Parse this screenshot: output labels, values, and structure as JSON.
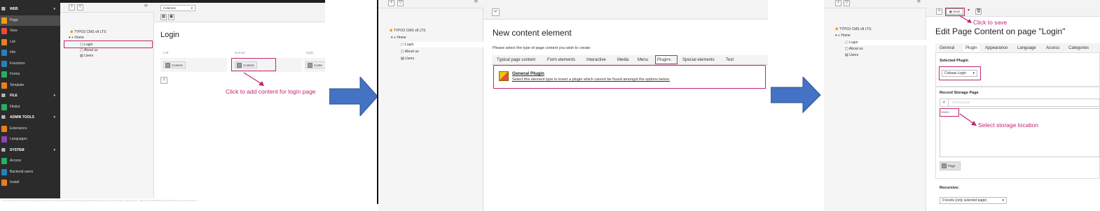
{
  "panel1": {
    "modules": [
      {
        "label": "WEB",
        "group": true,
        "color": "#e8e8e8"
      },
      {
        "label": "Page",
        "active": true,
        "color": "#f39c12"
      },
      {
        "label": "View",
        "color": "#e74c3c"
      },
      {
        "label": "List",
        "color": "#e67e22"
      },
      {
        "label": "Info",
        "color": "#2980b9"
      },
      {
        "label": "Functions",
        "color": "#2980b9"
      },
      {
        "label": "Forms",
        "color": "#27ae60"
      },
      {
        "label": "Template",
        "color": "#e67e22"
      },
      {
        "label": "FILE",
        "group": true,
        "color": "#e8e8e8"
      },
      {
        "label": "Filelist",
        "color": "#27ae60"
      },
      {
        "label": "ADMIN TOOLS",
        "group": true,
        "color": "#e8e8e8"
      },
      {
        "label": "Extensions",
        "color": "#e67e22"
      },
      {
        "label": "Languages",
        "color": "#8e44ad"
      },
      {
        "label": "SYSTEM",
        "group": true,
        "color": "#e8e8e8"
      },
      {
        "label": "Access",
        "color": "#27ae60"
      },
      {
        "label": "Backend users",
        "color": "#2980b9"
      },
      {
        "label": "Install",
        "color": "#e67e22"
      }
    ],
    "tree": {
      "root": "TYPO3 CMS v8 LTS",
      "home": "Home",
      "pages": [
        "Login",
        "About us",
        "Users"
      ]
    },
    "columns_select": "Columns",
    "page_title": "Login",
    "col_headers": [
      "Left",
      "Normal",
      "Right"
    ],
    "content_btn": "Content",
    "content_btn_right": "Conte",
    "callout": "Click to add content for login page",
    "url_text": "4.7/4.7d1/5 Hom/TYPO3/ modul=web_list&returnUrl=%2FtypoanalUrl%2Fn=modules&pageUid=4&recordTypes=tt_content&cmd[tt_content][new]=...&showNew=1&defVals[colPos]=0&edit[tt_content]=0&returnurl"
  },
  "panel2": {
    "tree": {
      "root": "TYPO3 CMS v8 LTS",
      "home": "Home",
      "pages": [
        "Login",
        "About us",
        "Users"
      ]
    },
    "heading": "New content element",
    "intro": "Please select the type of page content you wish to create:",
    "tabs": [
      "Typical page content",
      "Form elements",
      "Interactive",
      "Media",
      "Menu",
      "Plugins",
      "Special elements",
      "Text"
    ],
    "plugin_title": "General Plugin",
    "plugin_desc": "Select this element type to insert a plugin which cannot be found amongst the options below."
  },
  "panel3": {
    "tree": {
      "root": "TYPO3 CMS v8 LTS",
      "home": "Home",
      "pages": [
        "Login",
        "About us",
        "Users"
      ]
    },
    "save": "Save",
    "callout_save": "Click to save",
    "heading": "Edit Page Content on page \"Login\"",
    "tabs": [
      "General",
      "Plugin",
      "Appearance",
      "Language",
      "Access",
      "Categories"
    ],
    "selected_plugin_label": "Selected Plugin",
    "selected_plugin_value": "Cobaas Login",
    "storage_label": "Record Storage Page",
    "search_placeholder": "Find records",
    "storage_item": "Users",
    "callout_storage": "Select storage location",
    "page_btn": "Page",
    "recursive_label": "Recursive:",
    "recursive_value": "0 levels (only selected page)"
  },
  "colors": {
    "accent": "#c0266f",
    "arrow": "#4472c4",
    "module_bg": "#2b2b2b"
  }
}
